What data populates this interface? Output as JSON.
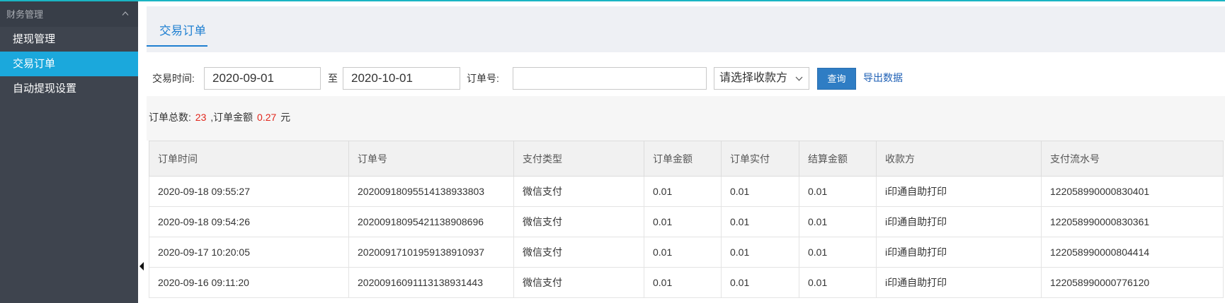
{
  "sidebar": {
    "group_title": "财务管理",
    "group_icon": "chevron-up-icon",
    "items": [
      {
        "label": "提现管理",
        "active": false
      },
      {
        "label": "交易订单",
        "active": true
      },
      {
        "label": "自动提现设置",
        "active": false
      }
    ],
    "collapse_icon": "triangle-left-icon"
  },
  "header": {
    "tab_label": "交易订单"
  },
  "filters": {
    "time_label": "交易时间:",
    "start_date": "2020-09-01",
    "separator": "至",
    "end_date": "2020-10-01",
    "order_no_label": "订单号:",
    "order_no_value": "",
    "payee_select": "请选择收款方",
    "payee_select_icon": "chevron-down-icon",
    "query_button": "查询",
    "export_link": "导出数据"
  },
  "summary": {
    "total_label": "订单总数:",
    "total_count": "23",
    "amount_label": ",订单金额",
    "amount": "0.27",
    "unit": "元"
  },
  "table": {
    "columns": [
      "订单时间",
      "订单号",
      "支付类型",
      "订单金额",
      "订单实付",
      "结算金额",
      "收款方",
      "支付流水号"
    ],
    "rows": [
      [
        "2020-09-18 09:55:27",
        "20200918095514138933803",
        "微信支付",
        "0.01",
        "0.01",
        "0.01",
        "i印通自助打印",
        "122058990000830401"
      ],
      [
        "2020-09-18 09:54:26",
        "20200918095421138908696",
        "微信支付",
        "0.01",
        "0.01",
        "0.01",
        "i印通自助打印",
        "122058990000830361"
      ],
      [
        "2020-09-17 10:20:05",
        "20200917101959138910937",
        "微信支付",
        "0.01",
        "0.01",
        "0.01",
        "i印通自助打印",
        "122058990000804414"
      ],
      [
        "2020-09-16 09:11:20",
        "20200916091113138931443",
        "微信支付",
        "0.01",
        "0.01",
        "0.01",
        "i印通自助打印",
        "122058990000776120"
      ]
    ]
  },
  "colors": {
    "accent": "#1e7fd1",
    "sidebar_bg": "#3e444e",
    "active_item": "#1ba8dc",
    "top_bar": "#1ab5c3",
    "highlight_number": "#e1251b",
    "button": "#2f7dc4",
    "link": "#1d5fb5"
  }
}
